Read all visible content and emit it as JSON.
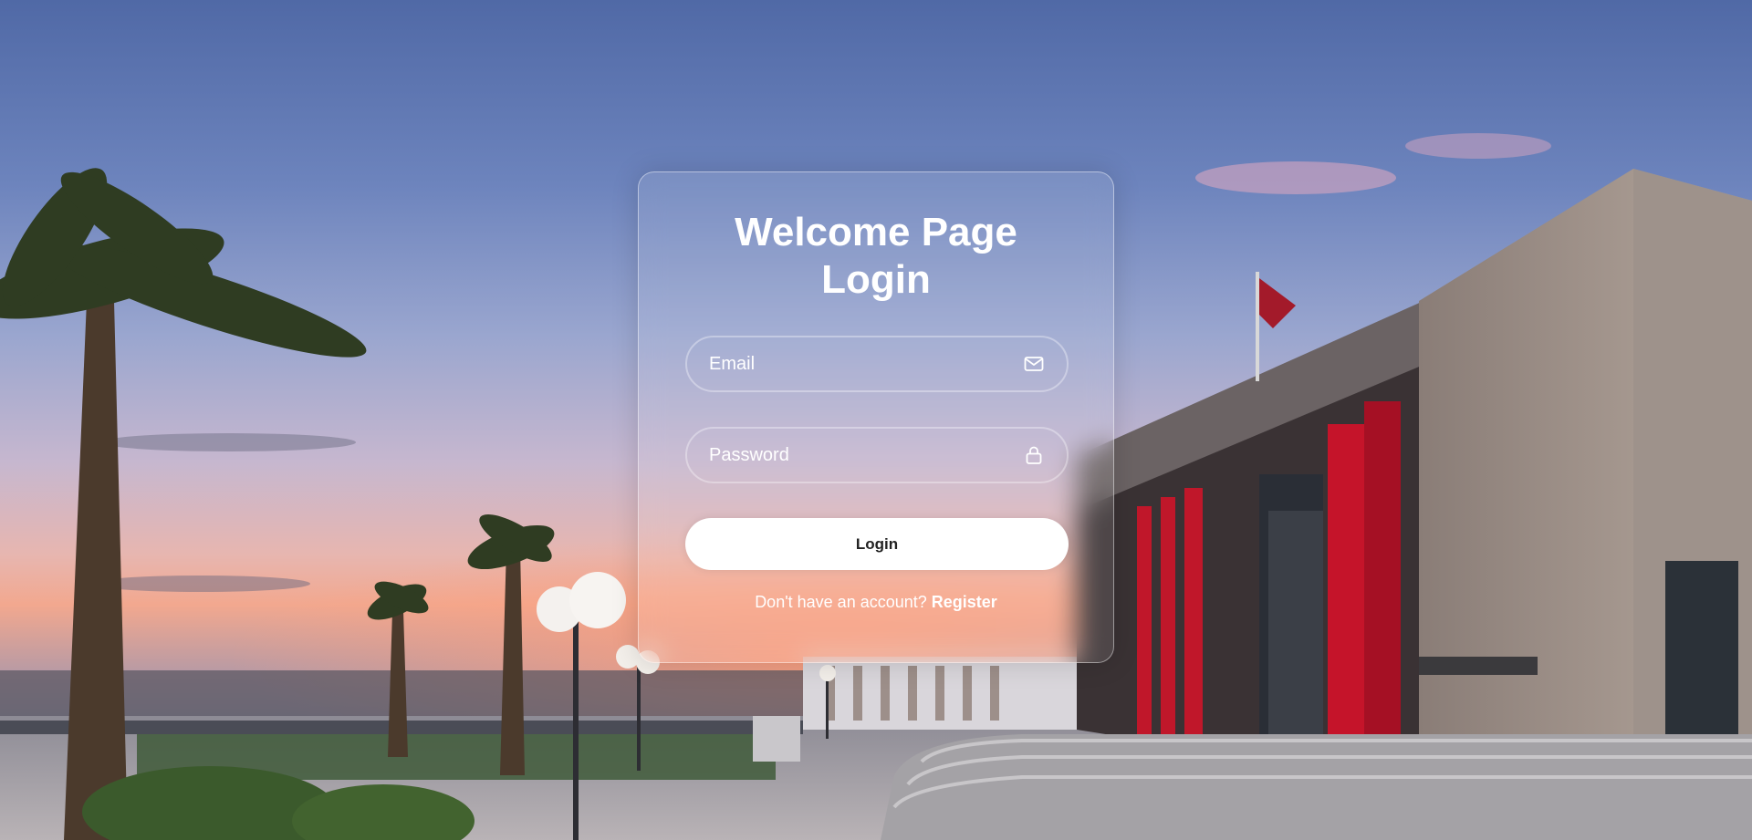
{
  "login_card": {
    "title_line1": "Welcome Page",
    "title_line2": "Login",
    "email_placeholder": "Email",
    "password_placeholder": "Password",
    "login_button_label": "Login",
    "register_prompt": "Don't have an account?",
    "register_link": "Register"
  },
  "icons": {
    "email": "envelope-icon",
    "password": "lock-icon"
  },
  "colors": {
    "card_border": "#ffffff",
    "button_background": "#ffffff",
    "button_text": "#222222",
    "text": "#ffffff"
  }
}
